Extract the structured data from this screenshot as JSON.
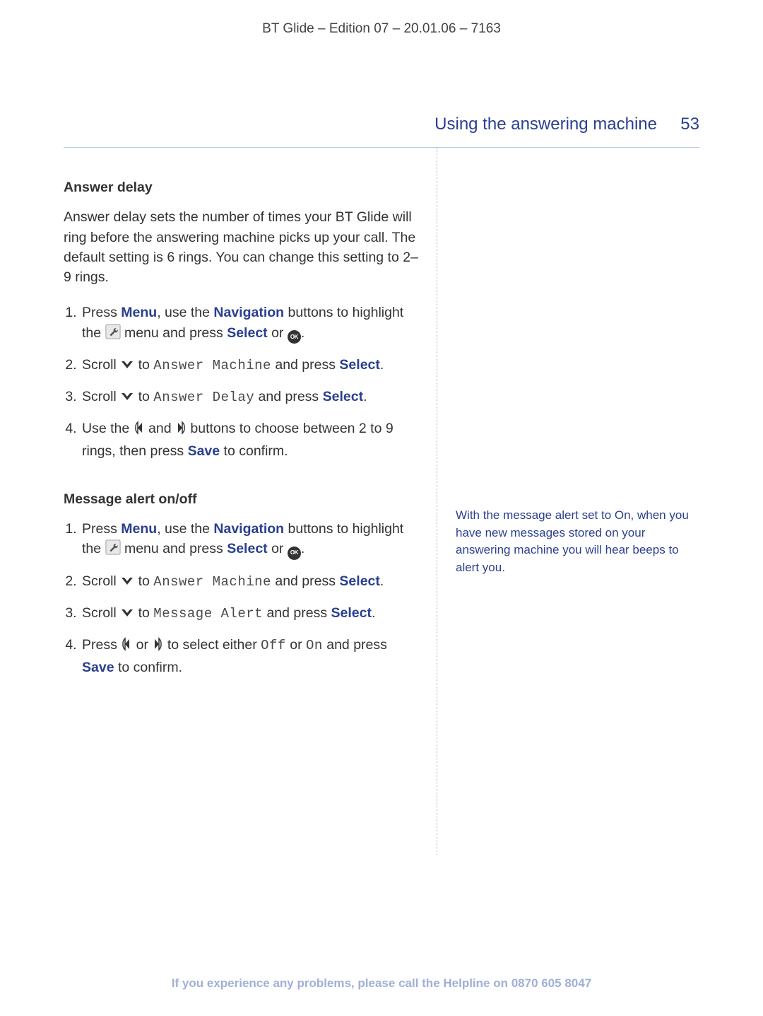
{
  "doc_header": "BT Glide – Edition 07 – 20.01.06 – 7163",
  "section_title": "Using the answering machine",
  "page_number": "53",
  "sec1": {
    "heading": "Answer delay",
    "intro": "Answer delay sets the number of times your BT Glide will ring before the answering machine picks up your call. The default setting is 6 rings. You can change this setting to 2–9 rings.",
    "s1a": "Press ",
    "s1_menu": "Menu",
    "s1b": ", use the ",
    "s1_nav": "Navigation",
    "s1c": " buttons to highlight the ",
    "s1d": " menu and press ",
    "s1_select": "Select",
    "s1e": " or ",
    "s1f": ".",
    "s2a": "Scroll ",
    "s2b": " to ",
    "s2_mono": "Answer Machine",
    "s2c": " and press ",
    "s2_select": "Select",
    "s2d": ".",
    "s3a": "Scroll ",
    "s3b": " to ",
    "s3_mono": "Answer Delay",
    "s3c": " and press ",
    "s3_select": "Select",
    "s3d": ".",
    "s4a": "Use the ",
    "s4b": " and ",
    "s4c": " buttons to choose between 2 to 9 rings, then press ",
    "s4_save": "Save",
    "s4d": " to confirm."
  },
  "sec2": {
    "heading": "Message alert on/off",
    "s1a": "Press ",
    "s1_menu": "Menu",
    "s1b": ", use the ",
    "s1_nav": "Navigation",
    "s1c": " buttons to highlight the ",
    "s1d": " menu and press ",
    "s1_select": "Select",
    "s1e": " or ",
    "s1f": ".",
    "s2a": "Scroll ",
    "s2b": " to ",
    "s2_mono": "Answer Machine",
    "s2c": " and press ",
    "s2_select": "Select",
    "s2d": ".",
    "s3a": "Scroll ",
    "s3b": " to ",
    "s3_mono": "Message Alert",
    "s3c": " and press ",
    "s3_select": "Select",
    "s3d": ".",
    "s4a": "Press ",
    "s4b": " or ",
    "s4c": " to select either ",
    "s4_off": "Off",
    "s4d": " or ",
    "s4_on": "On",
    "s4e": " and press ",
    "s4_save": "Save",
    "s4f": " to confirm."
  },
  "sidebar_note": "With the message alert set to On, when you have new messages stored on your answering machine you will hear beeps to alert you.",
  "footer_a": "If you experience any problems, please call the Helpline on ",
  "footer_b": "0870 605 8047",
  "ok_label": "OK"
}
